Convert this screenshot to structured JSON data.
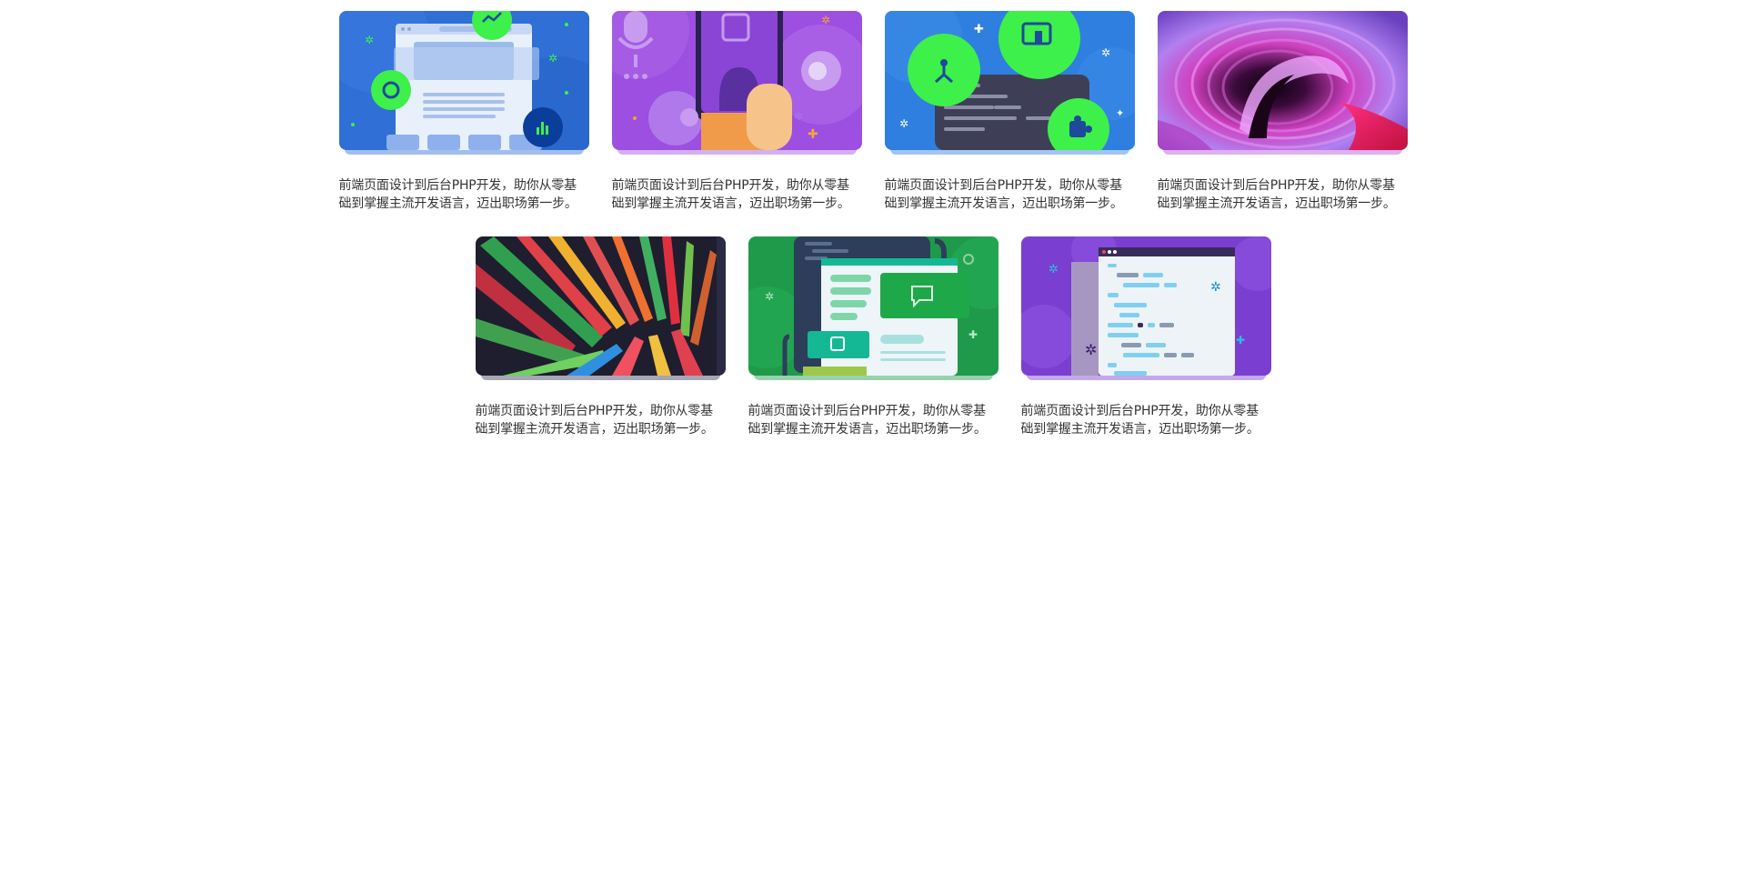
{
  "cards": [
    {
      "caption": "前端页面设计到后台PHP开发，助你从零基础到掌握主流开发语言，迈出职场第一步。",
      "image": "web-design-illustration",
      "accent": "#2f6fd6"
    },
    {
      "caption": "前端页面设计到后台PHP开发，助你从零基础到掌握主流开发语言，迈出职场第一步。",
      "image": "android-mobile-illustration",
      "accent": "#9c4fe0"
    },
    {
      "caption": "前端页面设计到后台PHP开发，助你从零基础到掌握主流开发语言，迈出职场第一步。",
      "image": "devices-code-illustration",
      "accent": "#2e7fe0"
    },
    {
      "caption": "前端页面设计到后台PHP开发，助你从零基础到掌握主流开发语言，迈出职场第一步。",
      "image": "spiral-abstract-art",
      "accent": "#b54fd6"
    },
    {
      "caption": "前端页面设计到后台PHP开发，助你从零基础到掌握主流开发语言，迈出职场第一步。",
      "image": "colorful-bars-abstract",
      "accent": "#3a3a5a"
    },
    {
      "caption": "前端页面设计到后台PHP开发，助你从零基础到掌握主流开发语言，迈出职场第一步。",
      "image": "messaging-ui-illustration",
      "accent": "#1f9a4a"
    },
    {
      "caption": "前端页面设计到后台PHP开发，助你从零基础到掌握主流开发语言，迈出职场第一步。",
      "image": "code-editor-illustration",
      "accent": "#7a3fd0"
    }
  ]
}
